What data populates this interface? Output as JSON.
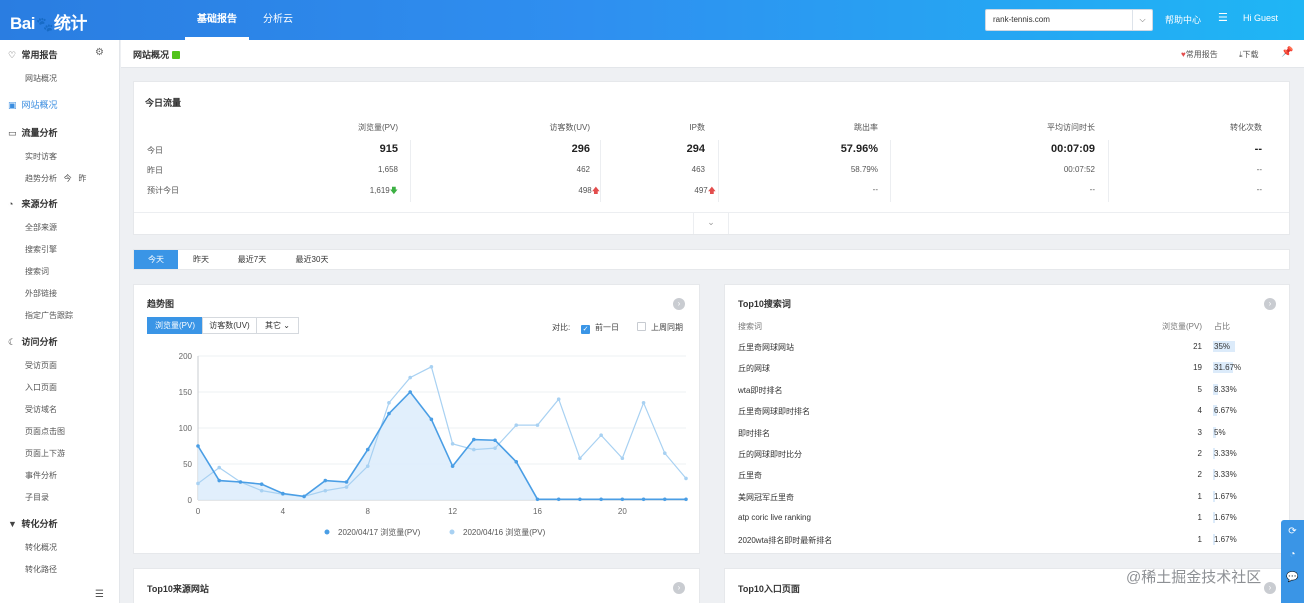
{
  "topbar": {
    "logo": "Bai",
    "logo_suffix": "统计",
    "tabs": [
      {
        "label": "基础报告",
        "active": true
      },
      {
        "label": "分析云",
        "active": false
      }
    ],
    "site": "rank-tennis.com",
    "help": "帮助中心",
    "greeting": "Hi  Guest"
  },
  "sidebar": {
    "groups": [
      {
        "label": "常用报告",
        "icon": "heart-icon",
        "items": [
          "网站概况"
        ]
      },
      {
        "label": "网站概况",
        "icon": "overview-icon",
        "active": true,
        "items": []
      },
      {
        "label": "流量分析",
        "icon": "monitor-icon",
        "items": [
          "实时访客",
          "趋势分析"
        ]
      },
      {
        "label": "来源分析",
        "icon": "pie-icon",
        "items": [
          "全部来源",
          "搜索引擎",
          "搜索词",
          "外部链接",
          "指定广告跟踪"
        ]
      },
      {
        "label": "访问分析",
        "icon": "moon-icon",
        "items": [
          "受访页面",
          "入口页面",
          "受访域名",
          "页面点击图",
          "页面上下游",
          "事件分析",
          "子目录"
        ]
      },
      {
        "label": "转化分析",
        "icon": "funnel-icon",
        "items": [
          "转化概况",
          "转化路径"
        ]
      }
    ],
    "trend_extra": [
      "今",
      "昨"
    ]
  },
  "page": {
    "title": "网站概况",
    "fav_label": "常用报告",
    "download_label": "下载"
  },
  "today": {
    "title": "今日流量",
    "columns": [
      "浏览量(PV)",
      "访客数(UV)",
      "IP数",
      "跳出率",
      "平均访问时长",
      "转化次数"
    ],
    "rows": [
      {
        "label": "今日",
        "values": [
          "915",
          "296",
          "294",
          "57.96%",
          "00:07:09",
          "--"
        ]
      },
      {
        "label": "昨日",
        "values": [
          "1,658",
          "462",
          "463",
          "58.79%",
          "00:07:52",
          "--"
        ]
      },
      {
        "label": "预计今日",
        "values": [
          "1,619",
          "498",
          "497",
          "--",
          "--",
          "--"
        ],
        "trends": [
          "down",
          "up",
          "up",
          "",
          "",
          ""
        ]
      }
    ]
  },
  "date_tabs": [
    "今天",
    "昨天",
    "最近7天",
    "最近30天"
  ],
  "trend": {
    "title": "趋势图",
    "metrics": [
      "浏览量(PV)",
      "访客数(UV)",
      "其它"
    ],
    "compare_label": "对比:",
    "compare_options": [
      {
        "label": "前一日",
        "checked": true
      },
      {
        "label": "上周同期",
        "checked": false
      }
    ]
  },
  "chart_data": {
    "type": "area",
    "x": [
      0,
      1,
      2,
      3,
      4,
      5,
      6,
      7,
      8,
      9,
      10,
      11,
      12,
      13,
      14,
      15,
      16,
      17,
      18,
      19,
      20,
      21,
      22,
      23
    ],
    "xticks": [
      0,
      4,
      8,
      12,
      16,
      20
    ],
    "ylim": [
      0,
      200
    ],
    "yticks": [
      0,
      50,
      100,
      150,
      200
    ],
    "series": [
      {
        "name": "2020/04/17 浏览量(PV)",
        "color": "#4a9ee5",
        "values": [
          75,
          27,
          25,
          22,
          9,
          5,
          27,
          25,
          70,
          120,
          150,
          112,
          47,
          84,
          83,
          53,
          1,
          1,
          1,
          1,
          1,
          1,
          1,
          1
        ]
      },
      {
        "name": "2020/04/16 浏览量(PV)",
        "color": "#a8d1f2",
        "values": [
          23,
          45,
          25,
          13,
          8,
          5,
          13,
          18,
          47,
          135,
          170,
          185,
          78,
          70,
          72,
          104,
          104,
          140,
          58,
          90,
          58,
          135,
          65,
          30
        ]
      }
    ],
    "legend": "bottom"
  },
  "keywords": {
    "title": "Top10搜索词",
    "headers": [
      "搜索词",
      "浏览量(PV)",
      "占比"
    ],
    "rows": [
      {
        "term": "丘里奇网球网站",
        "pv": "21",
        "pct": "35%",
        "share": 0.35
      },
      {
        "term": "丘的网球",
        "pv": "19",
        "pct": "31.67%",
        "share": 0.3167
      },
      {
        "term": "wta即时排名",
        "pv": "5",
        "pct": "8.33%",
        "share": 0.0833
      },
      {
        "term": "丘里奇网球即时排名",
        "pv": "4",
        "pct": "6.67%",
        "share": 0.0667
      },
      {
        "term": "即时排名",
        "pv": "3",
        "pct": "5%",
        "share": 0.05
      },
      {
        "term": "丘的网球即时比分",
        "pv": "2",
        "pct": "3.33%",
        "share": 0.0333
      },
      {
        "term": "丘里奇",
        "pv": "2",
        "pct": "3.33%",
        "share": 0.0333
      },
      {
        "term": "美网冠军丘里奇",
        "pv": "1",
        "pct": "1.67%",
        "share": 0.0167
      },
      {
        "term": "atp coric live ranking",
        "pv": "1",
        "pct": "1.67%",
        "share": 0.0167
      },
      {
        "term": "2020wta排名即时最新排名",
        "pv": "1",
        "pct": "1.67%",
        "share": 0.0167
      }
    ]
  },
  "bottom": {
    "sources_title": "Top10来源网站",
    "entry_title": "Top10入口页面"
  },
  "watermark": "@稀土掘金技术社区"
}
